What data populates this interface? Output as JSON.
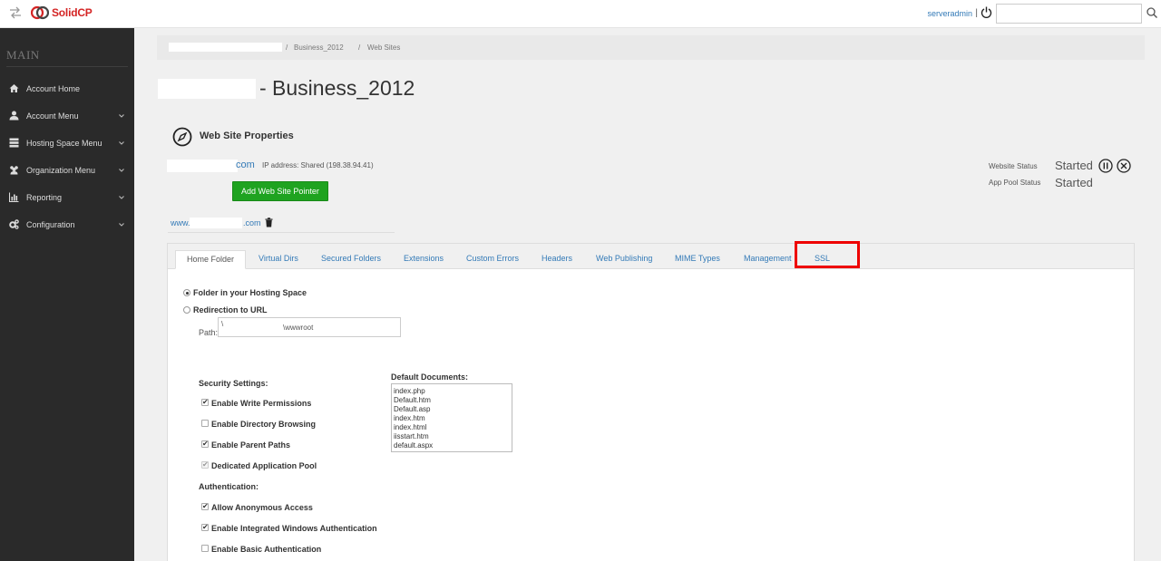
{
  "topbar": {
    "brand": "SolidCP",
    "user": "serveradmin",
    "user_separator": "|",
    "search": {
      "value": "",
      "placeholder": ""
    }
  },
  "sidebar": {
    "header": "MAIN",
    "items": [
      {
        "label": "Account Home",
        "icon": "home-icon",
        "has_caret": false
      },
      {
        "label": "Account Menu",
        "icon": "user-icon",
        "has_caret": true
      },
      {
        "label": "Hosting Space Menu",
        "icon": "server-icon",
        "has_caret": true
      },
      {
        "label": "Organization Menu",
        "icon": "users-icon",
        "has_caret": true
      },
      {
        "label": "Reporting",
        "icon": "bar-chart-icon",
        "has_caret": true
      },
      {
        "label": "Configuration",
        "icon": "gears-icon",
        "has_caret": true
      }
    ]
  },
  "breadcrumb": {
    "sep": "/",
    "space": "Business_2012",
    "current": "Web Sites"
  },
  "page": {
    "title": "- Business_2012"
  },
  "site": {
    "section_title": "Web Site Properties",
    "domain_tld": "com",
    "ip_address": "IP address: Shared (198.38.94.41)",
    "add_pointer_label": "Add Web Site Pointer",
    "website_status_label": "Website Status",
    "website_status_value": "Started",
    "app_pool_status_label": "App Pool Status",
    "app_pool_status_value": "Started",
    "pointer_prefix": "www.",
    "pointer_suffix": ".com"
  },
  "tabs": [
    {
      "label": "Home Folder",
      "active": true
    },
    {
      "label": "Virtual Dirs",
      "active": false
    },
    {
      "label": "Secured Folders",
      "active": false
    },
    {
      "label": "Extensions",
      "active": false
    },
    {
      "label": "Custom Errors",
      "active": false
    },
    {
      "label": "Headers",
      "active": false
    },
    {
      "label": "Web Publishing",
      "active": false
    },
    {
      "label": "MIME Types",
      "active": false
    },
    {
      "label": "Management",
      "active": false
    },
    {
      "label": "SSL",
      "active": false,
      "highlighted": true
    }
  ],
  "home_folder": {
    "option_folder": "Folder in your Hosting Space",
    "option_redirect": "Redirection to URL",
    "selected_option": "folder",
    "path_label": "Path:",
    "path_start": "\\",
    "path_end": "\\wwwroot",
    "security_title": "Security Settings:",
    "security": [
      {
        "label": "Enable Write Permissions",
        "checked": true,
        "disabled": false
      },
      {
        "label": "Enable Directory Browsing",
        "checked": false,
        "disabled": false
      },
      {
        "label": "Enable Parent Paths",
        "checked": true,
        "disabled": false
      },
      {
        "label": "Dedicated Application Pool",
        "checked": true,
        "disabled": true
      }
    ],
    "auth_title": "Authentication:",
    "auth": [
      {
        "label": "Allow Anonymous Access",
        "checked": true
      },
      {
        "label": "Enable Integrated Windows Authentication",
        "checked": true
      },
      {
        "label": "Enable Basic Authentication",
        "checked": false
      }
    ],
    "default_docs_title": "Default Documents:",
    "default_docs": "index.php\nDefault.htm\nDefault.asp\nindex.htm\nindex.html\niisstart.htm\ndefault.aspx"
  },
  "colors": {
    "accent_link": "#337ab7",
    "button_green": "#1fa320",
    "sidebar_bg": "#2a2a2a",
    "brand_red": "#d42424",
    "highlight_red": "#ee0000"
  }
}
